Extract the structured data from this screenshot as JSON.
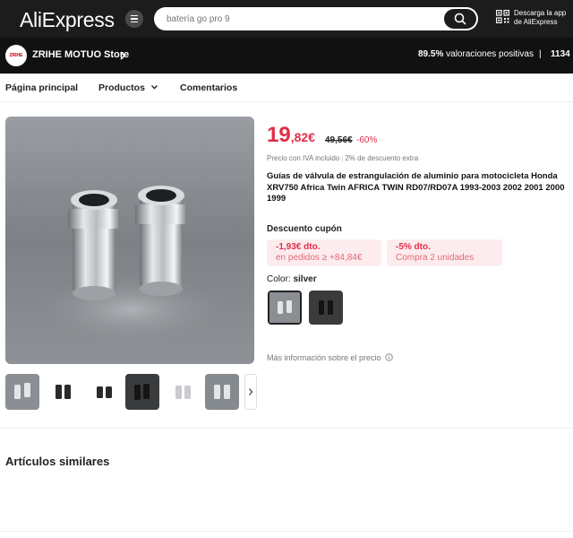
{
  "header": {
    "logo": "AliExpress",
    "search_placeholder": "batería go pro 9",
    "app_line1": "Descarga la app",
    "app_line2": "de AliExpress"
  },
  "store": {
    "logo_text": "ZRIHE",
    "name": "ZRIHE MOTUO Store",
    "rating_value": "89.5%",
    "rating_label": "valoraciones positivas",
    "separator": "|",
    "followers": "1134"
  },
  "nav": {
    "home": "Página principal",
    "products": "Productos",
    "reviews": "Comentarios"
  },
  "product": {
    "price_int": "19",
    "price_dec": ",82€",
    "old_price": "49,56€",
    "discount": "-60%",
    "vat_note": "Precio con IVA incluido",
    "vat_sep": "|",
    "extra_discount": "2% de descuento extra",
    "title": "Guías de válvula de estrangulación de aluminio para motocicleta Honda XRV750 Africa Twin AFRICA TWIN RD07/RD07A 1993-2003 2002 2001 2000 1999",
    "coupon_heading": "Descuento cupón",
    "coupons": [
      {
        "line1": "-1,93€ dto.",
        "line2": "en pedidos ≥ +84,84€"
      },
      {
        "line1": "-5% dto.",
        "line2": "Compra 2 unidades"
      }
    ],
    "color_label": "Color:",
    "color_value": "silver",
    "more_info": "Más información sobre el precio"
  },
  "similar_heading": "Artículos similares",
  "colors": {
    "price_red": "#e02f4a",
    "coupon_bg": "#fdecee",
    "header_bg": "#1c1c1c"
  }
}
